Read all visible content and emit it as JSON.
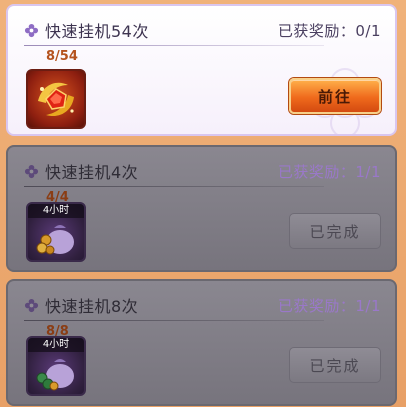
{
  "tasks": [
    {
      "title": "快速挂机54次",
      "reward_label": "已获奖励：0/1",
      "progress": "8/54",
      "item_tag": "",
      "button": "前往",
      "state": "active"
    },
    {
      "title": "快速挂机4次",
      "reward_label": "已获奖励：1/1",
      "progress": "4/4",
      "item_tag": "4小时",
      "button": "已完成",
      "state": "completed"
    },
    {
      "title": "快速挂机8次",
      "reward_label": "已获奖励：1/1",
      "progress": "8/8",
      "item_tag": "4小时",
      "button": "已完成",
      "state": "completed"
    }
  ],
  "icons": {
    "task_icon": "flower-icon",
    "reward_items": [
      "red-gem-chest-icon",
      "coin-bag-icon",
      "coin-bag-icon"
    ]
  },
  "colors": {
    "progress_active": "#b5531e",
    "go_button": "#ef6a1c",
    "completed_reward": "#9a78c9"
  }
}
